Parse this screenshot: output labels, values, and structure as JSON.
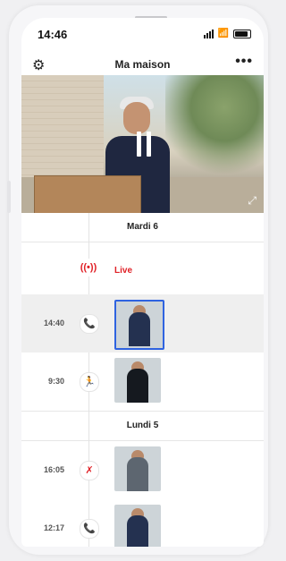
{
  "status_bar": {
    "time": "14:46"
  },
  "header": {
    "title": "Ma maison",
    "settings_icon": "gear-icon",
    "more_icon": "more-icon"
  },
  "video": {
    "state_icon": "pause-icon",
    "expand_icon": "expand-icon"
  },
  "timeline": {
    "days": [
      {
        "label": "Mardi 6"
      },
      {
        "label": "Lundi 5"
      }
    ],
    "live": {
      "label": "Live",
      "icon": "live-broadcast-icon",
      "color": "#e02127"
    },
    "events": [
      {
        "time": "14:40",
        "icon": "phone-icon",
        "icon_color": "#2bb04a",
        "selected": true
      },
      {
        "time": "9:30",
        "icon": "motion-icon",
        "icon_color": "#27a7a3",
        "selected": false
      },
      {
        "time": "16:05",
        "icon": "missed-call-icon",
        "icon_color": "#e02127",
        "selected": false
      },
      {
        "time": "12:17",
        "icon": "phone-icon",
        "icon_color": "#2bb04a",
        "selected": false
      }
    ]
  }
}
